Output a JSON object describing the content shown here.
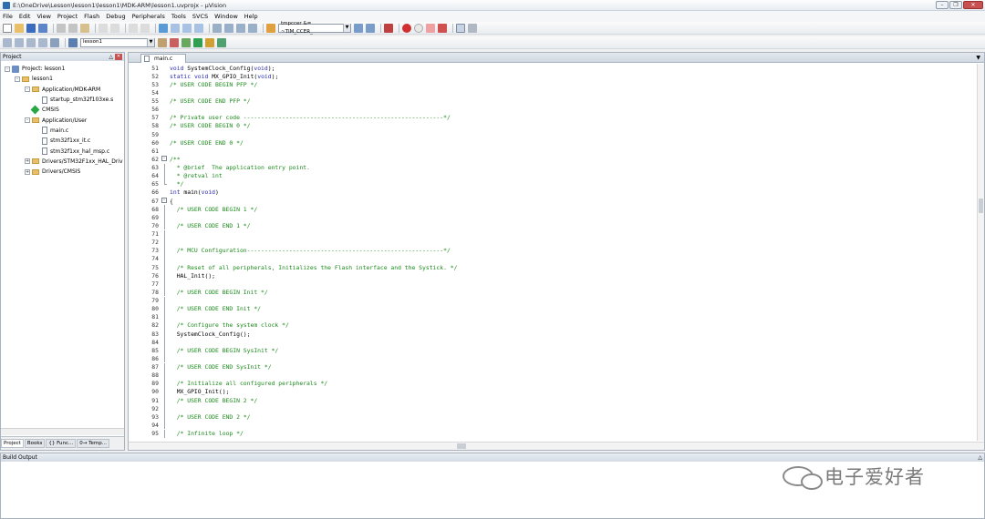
{
  "window": {
    "title": "E:\\OneDrive\\Lesson\\lesson1\\lesson1\\MDK-ARM\\lesson1.uvprojx - µVision"
  },
  "menu": [
    "File",
    "Edit",
    "View",
    "Project",
    "Flash",
    "Debug",
    "Peripherals",
    "Tools",
    "SVCS",
    "Window",
    "Help"
  ],
  "toolbar": {
    "find_combo": "tmpccer &= ~TIM_CCER_",
    "target_combo": "lesson1"
  },
  "project_panel": {
    "title": "Project",
    "tree": [
      {
        "label": "Project: lesson1",
        "level": 0,
        "kind": "project",
        "exp": "-"
      },
      {
        "label": "lesson1",
        "level": 1,
        "kind": "target",
        "exp": "-"
      },
      {
        "label": "Application/MDK-ARM",
        "level": 2,
        "kind": "folder",
        "exp": "-"
      },
      {
        "label": "startup_stm32f103xe.s",
        "level": 3,
        "kind": "file",
        "exp": ""
      },
      {
        "label": "CMSIS",
        "level": 2,
        "kind": "gem",
        "exp": ""
      },
      {
        "label": "Application/User",
        "level": 2,
        "kind": "folder",
        "exp": "-"
      },
      {
        "label": "main.c",
        "level": 3,
        "kind": "file",
        "exp": ""
      },
      {
        "label": "stm32f1xx_it.c",
        "level": 3,
        "kind": "file",
        "exp": ""
      },
      {
        "label": "stm32f1xx_hal_msp.c",
        "level": 3,
        "kind": "file",
        "exp": ""
      },
      {
        "label": "Drivers/STM32F1xx_HAL_Driv",
        "level": 2,
        "kind": "folder",
        "exp": "+"
      },
      {
        "label": "Drivers/CMSIS",
        "level": 2,
        "kind": "folder",
        "exp": "+"
      }
    ],
    "tabs": [
      "Project",
      "Books",
      "{} Func...",
      "0→ Temp..."
    ]
  },
  "editor": {
    "tab": "main.c",
    "lines": [
      {
        "n": "51",
        "t": "void SystemClock_Config(void);",
        "c": "pl"
      },
      {
        "n": "52",
        "t": "static void MX_GPIO_Init(void);",
        "c": "pl"
      },
      {
        "n": "53",
        "t": "/* USER CODE BEGIN PFP */",
        "c": "cm"
      },
      {
        "n": "54",
        "t": "",
        "c": "pl"
      },
      {
        "n": "55",
        "t": "/* USER CODE END PFP */",
        "c": "cm"
      },
      {
        "n": "56",
        "t": "",
        "c": "pl"
      },
      {
        "n": "57",
        "t": "/* Private user code ---------------------------------------------------------*/",
        "c": "cm"
      },
      {
        "n": "58",
        "t": "/* USER CODE BEGIN 0 */",
        "c": "cm"
      },
      {
        "n": "59",
        "t": "",
        "c": "pl"
      },
      {
        "n": "60",
        "t": "/* USER CODE END 0 */",
        "c": "cm"
      },
      {
        "n": "61",
        "t": "",
        "c": "pl"
      },
      {
        "n": "62",
        "t": "/**",
        "c": "cm",
        "g": "fold"
      },
      {
        "n": "63",
        "t": "  * @brief  The application entry point.",
        "c": "cm",
        "g": "vl"
      },
      {
        "n": "64",
        "t": "  * @retval int",
        "c": "cm",
        "g": "vl"
      },
      {
        "n": "65",
        "t": "  */",
        "c": "cm",
        "g": "end"
      },
      {
        "n": "66",
        "t": "int main(void)",
        "c": "pl"
      },
      {
        "n": "67",
        "t": "{",
        "c": "pl",
        "g": "fold"
      },
      {
        "n": "68",
        "t": "  /* USER CODE BEGIN 1 */",
        "c": "cm",
        "g": "vl"
      },
      {
        "n": "69",
        "t": "",
        "c": "pl",
        "g": "vl"
      },
      {
        "n": "70",
        "t": "  /* USER CODE END 1 */",
        "c": "cm",
        "g": "vl"
      },
      {
        "n": "71",
        "t": "",
        "c": "pl",
        "g": "vl"
      },
      {
        "n": "72",
        "t": "",
        "c": "pl",
        "g": "vl"
      },
      {
        "n": "73",
        "t": "  /* MCU Configuration--------------------------------------------------------*/",
        "c": "cm",
        "g": "vl"
      },
      {
        "n": "74",
        "t": "",
        "c": "pl",
        "g": "vl"
      },
      {
        "n": "75",
        "t": "  /* Reset of all peripherals, Initializes the Flash interface and the Systick. */",
        "c": "cm",
        "g": "vl"
      },
      {
        "n": "76",
        "t": "  HAL_Init();",
        "c": "pl",
        "g": "vl"
      },
      {
        "n": "77",
        "t": "",
        "c": "pl",
        "g": "vl"
      },
      {
        "n": "78",
        "t": "  /* USER CODE BEGIN Init */",
        "c": "cm",
        "g": "vl"
      },
      {
        "n": "79",
        "t": "",
        "c": "pl",
        "g": "vl"
      },
      {
        "n": "80",
        "t": "  /* USER CODE END Init */",
        "c": "cm",
        "g": "vl"
      },
      {
        "n": "81",
        "t": "",
        "c": "pl",
        "g": "vl"
      },
      {
        "n": "82",
        "t": "  /* Configure the system clock */",
        "c": "cm",
        "g": "vl"
      },
      {
        "n": "83",
        "t": "  SystemClock_Config();",
        "c": "pl",
        "g": "vl"
      },
      {
        "n": "84",
        "t": "",
        "c": "pl",
        "g": "vl"
      },
      {
        "n": "85",
        "t": "  /* USER CODE BEGIN SysInit */",
        "c": "cm",
        "g": "vl"
      },
      {
        "n": "86",
        "t": "",
        "c": "pl",
        "g": "vl"
      },
      {
        "n": "87",
        "t": "  /* USER CODE END SysInit */",
        "c": "cm",
        "g": "vl"
      },
      {
        "n": "88",
        "t": "",
        "c": "pl",
        "g": "vl"
      },
      {
        "n": "89",
        "t": "  /* Initialize all configured peripherals */",
        "c": "cm",
        "g": "vl"
      },
      {
        "n": "90",
        "t": "  MX_GPIO_Init();",
        "c": "pl",
        "g": "vl"
      },
      {
        "n": "91",
        "t": "  /* USER CODE BEGIN 2 */",
        "c": "cm",
        "g": "vl"
      },
      {
        "n": "92",
        "t": "",
        "c": "pl",
        "g": "vl"
      },
      {
        "n": "93",
        "t": "  /* USER CODE END 2 */",
        "c": "cm",
        "g": "vl"
      },
      {
        "n": "94",
        "t": "",
        "c": "pl",
        "g": "vl"
      },
      {
        "n": "95",
        "t": "  /* Infinite loop */",
        "c": "cm",
        "g": "vl"
      }
    ]
  },
  "build_output": {
    "title": "Build Output"
  },
  "watermark": {
    "text": "电子爱好者"
  },
  "colors": {
    "keyword": "#2a2ab0",
    "comment": "#1a8a1a",
    "panel_border": "#a9b3bf"
  }
}
